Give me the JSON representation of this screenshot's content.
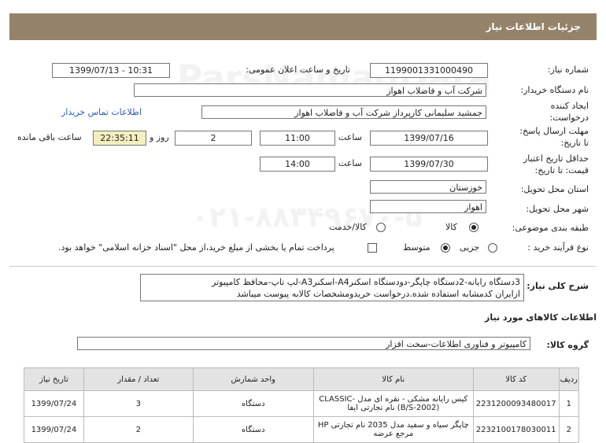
{
  "header": {
    "title": "جزئیات اطلاعات نیاز"
  },
  "fields": {
    "need_number_label": "شماره نیاز:",
    "need_number": "1199001331000490",
    "announce_label": "تاریخ و ساعت اعلان عمومی:",
    "announce_value": "1399/07/13 - 10:31",
    "buyer_org_label": "نام دستگاه خریدار:",
    "buyer_org": "شرکت آب و فاضلاب اهواز",
    "creator_label_1": "ایجاد کننده",
    "creator_label_2": "درخواست:",
    "creator": "جمشید سلیمانی کارپرداز شرکت آب و فاضلاب اهواز",
    "contact_link": "اطلاعات تماس خریدار",
    "deadline_label_1": "مهلت ارسال پاسخ:",
    "deadline_label_2": "تا تاریخ:",
    "deadline_date": "1399/07/16",
    "time_label": "ساعت",
    "deadline_time": "11:00",
    "days_value": "2",
    "days_label": "روز و",
    "remaining_time": "22:35:11",
    "remaining_label": "ساعت باقی مانده",
    "validity_label_1": "حداقل تاریخ اعتبار",
    "validity_label_2": "قیمت: تا تاریخ:",
    "validity_date": "1399/07/30",
    "validity_time": "14:00",
    "province_label": "استان محل تحویل:",
    "province": "خوزستان",
    "city_label": "شهر محل تحویل:",
    "city": "اهواز",
    "category_label": "طبقه بندی موضوعی:",
    "category_goods": "کالا",
    "category_goods_service": "کالا/خدمت",
    "process_label": "نوع فرآیند خرید :",
    "process_minor": "جزیی",
    "process_medium": "متوسط",
    "payment_note": "پرداخت تمام یا بخشی از مبلغ خرید،از محل \"اسناد خزانه اسلامی\" خواهد بود."
  },
  "description": {
    "label": "شرح کلی نیاز:",
    "line1": "3دستگاه رایانه-2دستگاه چاپگر-دودستگاه اسکنرA4-اسکنرA3-لپ تاپ-محافظ کامپیوتر",
    "line2": "ازایران کدمشابه استفاده شده.درخواست خریدومشخصات کالابه پیوست میباشد"
  },
  "goods": {
    "section_title": "اطلاعات کالاهای مورد نیاز",
    "group_label": "گروه کالا:",
    "group_value": "کامپیوتر و فناوری اطلاعات-سخت افزار",
    "columns": [
      "ردیف",
      "کد کالا",
      "نام کالا",
      "واحد شمارش",
      "تعداد / مقدار",
      "تاریخ نیاز"
    ],
    "rows": [
      {
        "index": "1",
        "code": "2231200093480017",
        "name": "کیس رایانه مشکی - نقره ای مدل CLASSIC-(B/S-2002) نام تجارتی ایفا",
        "unit": "دستگاه",
        "qty": "3",
        "date": "1399/07/24"
      },
      {
        "index": "2",
        "code": "2232100178030011",
        "name": "چاپگر سیاه و سفید مدل 2035 نام تجارتی HP مرجع عرضه",
        "unit": "دستگاه",
        "qty": "2",
        "date": "1399/07/24"
      }
    ]
  },
  "watermark": {
    "line1": "ParsNamadData",
    "line2": "۰۲۱-۸۸۳۴۹۶۷۰-۵"
  }
}
